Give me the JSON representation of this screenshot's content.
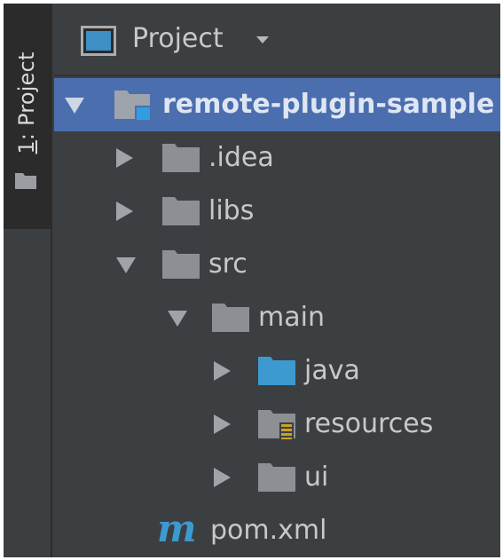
{
  "sidebar": {
    "tab_number": "1",
    "tab_text": ": Project"
  },
  "header": {
    "title": "Project"
  },
  "tree": {
    "root": "remote-plugin-sample",
    "idea": ".idea",
    "libs": "libs",
    "src": "src",
    "main": "main",
    "java": "java",
    "resources": "resources",
    "ui": "ui",
    "pom": "pom.xml",
    "pom_glyph": "m"
  },
  "colors": {
    "background": "#3c3f41",
    "selection": "#4b6eaf",
    "folder": "#8c9094",
    "source_folder": "#3d9ad1",
    "maven": "#3d9ad1"
  },
  "icons": {
    "project_view": "project-window-icon",
    "folder": "folder-icon",
    "module": "module-folder-icon",
    "sources": "source-folder-icon",
    "resources": "resources-folder-icon",
    "maven": "maven-icon"
  }
}
